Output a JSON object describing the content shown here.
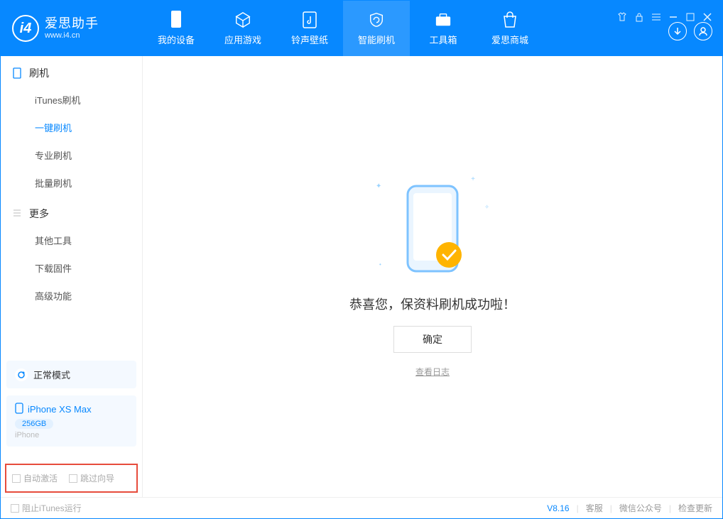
{
  "brand": {
    "name": "爱思助手",
    "url": "www.i4.cn"
  },
  "tabs": [
    {
      "label": "我的设备"
    },
    {
      "label": "应用游戏"
    },
    {
      "label": "铃声壁纸"
    },
    {
      "label": "智能刷机"
    },
    {
      "label": "工具箱"
    },
    {
      "label": "爱思商城"
    }
  ],
  "sidebar": {
    "section1": {
      "title": "刷机",
      "items": [
        "iTunes刷机",
        "一键刷机",
        "专业刷机",
        "批量刷机"
      ]
    },
    "section2": {
      "title": "更多",
      "items": [
        "其他工具",
        "下载固件",
        "高级功能"
      ]
    }
  },
  "mode": {
    "label": "正常模式"
  },
  "device": {
    "name": "iPhone XS Max",
    "capacity": "256GB",
    "type": "iPhone"
  },
  "checks": {
    "auto_activate": "自动激活",
    "skip_guide": "跳过向导"
  },
  "main": {
    "success": "恭喜您，保资料刷机成功啦！",
    "ok": "确定",
    "view_log": "查看日志"
  },
  "footer": {
    "block_itunes": "阻止iTunes运行",
    "version": "V8.16",
    "support": "客服",
    "wechat": "微信公众号",
    "check_update": "检查更新"
  }
}
